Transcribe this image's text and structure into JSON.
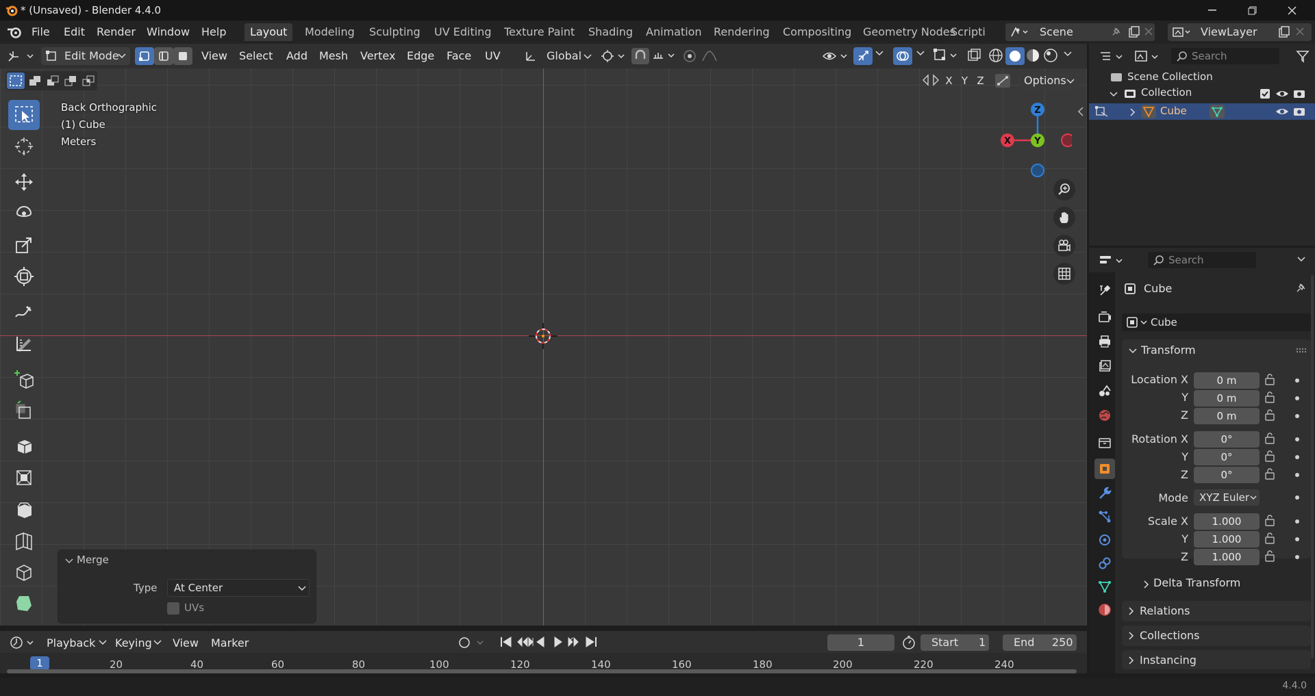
{
  "window": {
    "title": "* (Unsaved) - Blender 4.4.0"
  },
  "menu": [
    "File",
    "Edit",
    "Render",
    "Window",
    "Help"
  ],
  "workspaces": [
    "Layout",
    "Modeling",
    "Sculpting",
    "UV Editing",
    "Texture Paint",
    "Shading",
    "Animation",
    "Rendering",
    "Compositing",
    "Geometry Nodes",
    "Scripti"
  ],
  "scene": {
    "name": "Scene",
    "view_layer": "ViewLayer"
  },
  "header3d": {
    "mode": "Edit Mode",
    "menus": [
      "View",
      "Select",
      "Add",
      "Mesh",
      "Vertex",
      "Edge",
      "Face",
      "UV"
    ],
    "orientation": "Global",
    "axes": [
      "X",
      "Y",
      "Z"
    ],
    "options": "Options"
  },
  "viewport": {
    "view": "Back Orthographic",
    "object": "(1) Cube",
    "units": "Meters"
  },
  "gizmo": {
    "x": "X",
    "y": "Y",
    "z": "Z"
  },
  "merge_panel": {
    "title": "Merge",
    "type_label": "Type",
    "type_value": "At Center",
    "uvs_label": "UVs"
  },
  "outliner": {
    "search_placeholder": "Search",
    "scene_collection": "Scene Collection",
    "collection": "Collection",
    "object": "Cube"
  },
  "properties": {
    "search_placeholder": "Search",
    "object_name": "Cube",
    "object_field": "Cube",
    "transform": "Transform",
    "location_label": "Location X",
    "rotation_label": "Rotation X",
    "scale_label": "Scale X",
    "y": "Y",
    "z": "Z",
    "location": [
      "0 m",
      "0 m",
      "0 m"
    ],
    "rotation": [
      "0°",
      "0°",
      "0°"
    ],
    "mode_label": "Mode",
    "mode_value": "XYZ Euler",
    "scale": [
      "1.000",
      "1.000",
      "1.000"
    ],
    "delta": "Delta Transform",
    "relations": "Relations",
    "collections": "Collections",
    "instancing": "Instancing"
  },
  "timeline": {
    "menus": [
      "Playback",
      "Keying",
      "View",
      "Marker"
    ],
    "frame": "1",
    "start_label": "Start",
    "start": "1",
    "end_label": "End",
    "end": "250",
    "ruler": [
      "1",
      "20",
      "40",
      "60",
      "80",
      "100",
      "120",
      "140",
      "160",
      "180",
      "200",
      "220",
      "240"
    ]
  },
  "status": {
    "version": "4.4.0"
  },
  "colors": {
    "accent": "#4772b3",
    "x_axis": "#e13a4c",
    "y_axis": "#7cc31f",
    "z_axis": "#2f7fd6",
    "orange": "#f08d2a"
  }
}
